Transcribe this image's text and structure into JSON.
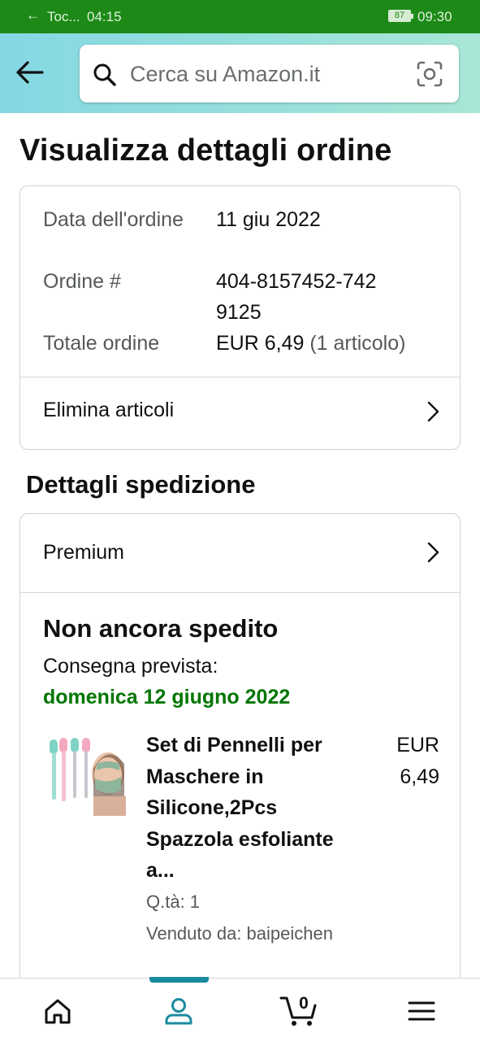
{
  "status_bar": {
    "app_label": "Toc...",
    "left_time": "04:15",
    "battery": "87",
    "right_time": "09:30"
  },
  "search": {
    "placeholder": "Cerca su Amazon.it"
  },
  "page_title": "Visualizza dettagli ordine",
  "order_summary": {
    "date_label": "Data dell'ordine",
    "date_value": "11 giu 2022",
    "order_label": "Ordine #",
    "order_value": "404-8157452-7429125",
    "total_label": "Totale ordine",
    "total_value": "EUR 6,49",
    "total_items": "(1 articolo)",
    "delete_items_label": "Elimina articoli"
  },
  "shipping": {
    "section_title": "Dettagli spedizione",
    "shipping_speed": "Premium",
    "status_title": "Non ancora spedito",
    "delivery_label": "Consegna prevista:",
    "delivery_date": "domenica 12 giugno 2022",
    "colors": {
      "delivery_date": "#007600"
    },
    "item": {
      "name": "Set di Pennelli per Maschere in Silicone,2Pcs Spazzola esfoliante a...",
      "price": "EUR 6,49",
      "quantity": "Q.tà: 1",
      "seller": "Venduto da: baipeichen"
    }
  },
  "tab_bar": {
    "cart_count": "0",
    "items": [
      "home-icon",
      "account-icon",
      "cart-icon",
      "menu-icon"
    ],
    "active": "account-icon",
    "active_color": "#1a8aa0"
  }
}
